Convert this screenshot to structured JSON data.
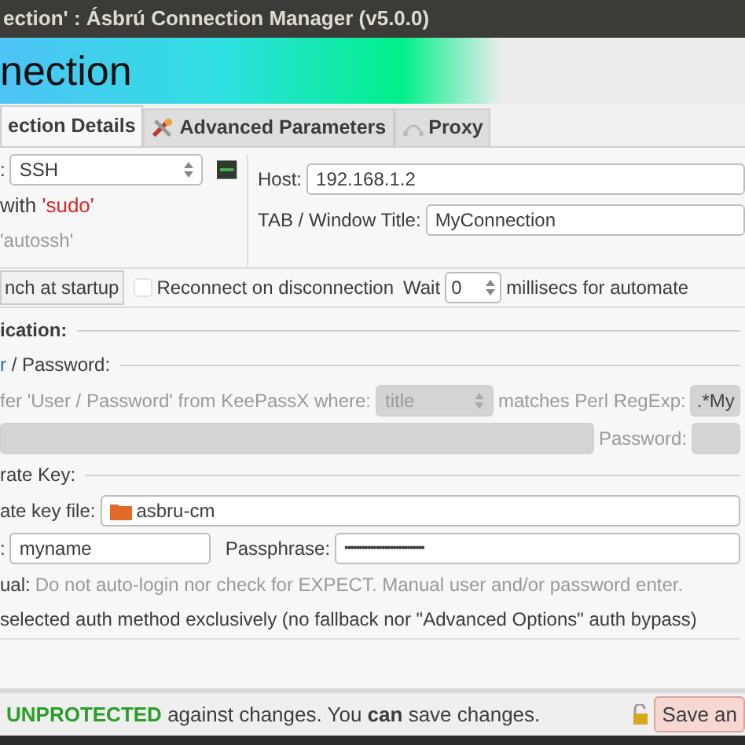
{
  "window": {
    "title": "ection' : Ásbrú Connection Manager (v5.0.0)"
  },
  "banner": {
    "title": "nection"
  },
  "tabs": [
    {
      "label": "ection Details",
      "selected": true,
      "kind": "plain"
    },
    {
      "label": "Advanced Parameters",
      "selected": false,
      "kind": "tools"
    },
    {
      "label": "Proxy",
      "selected": false,
      "kind": "proxy"
    }
  ],
  "connection": {
    "method_label": ":",
    "method": "SSH",
    "sudo_prefix": "with",
    "sudo": "'sudo'",
    "autossh": "'autossh'",
    "host_label": "Host:",
    "host": "192.168.1.2",
    "title_label": "TAB / Window Title:",
    "title": "MyConnection"
  },
  "options": {
    "launch": "nch at startup",
    "reconnect": {
      "label": "Reconnect on disconnection",
      "checked": false
    },
    "wait_label": "Wait",
    "wait": "0",
    "wait_suffix": "millisecs for automate"
  },
  "authentication": {
    "heading": "ication:",
    "user_password": {
      "heading_start": "r",
      "heading_rest": "/ Password:",
      "keepass": {
        "label": "fer 'User / Password' from KeePassX where:",
        "field": "title",
        "match_label": "matches Perl RegExp:",
        "regexp": ".*My",
        "disabled": true
      },
      "password_label": "Password:"
    },
    "private_key": {
      "heading": "rate Key:",
      "file_label": "ate key file:",
      "file": "asbru-cm",
      "user_label": ":",
      "user": "myname",
      "passphrase_label": "Passphrase:",
      "passphrase": "••••••••••••••••••••••••••••"
    },
    "manual": {
      "label": "ual:",
      "text": "Do not auto-login nor check for EXPECT. Manual user and/or password enter."
    },
    "exclusive": "selected auth method exclusively (no fallback nor \"Advanced Options\" auth bypass)"
  },
  "status_bar": {
    "text": "**UNPROTECTED** against changes. You **can** save changes.",
    "save": "Save an"
  }
}
